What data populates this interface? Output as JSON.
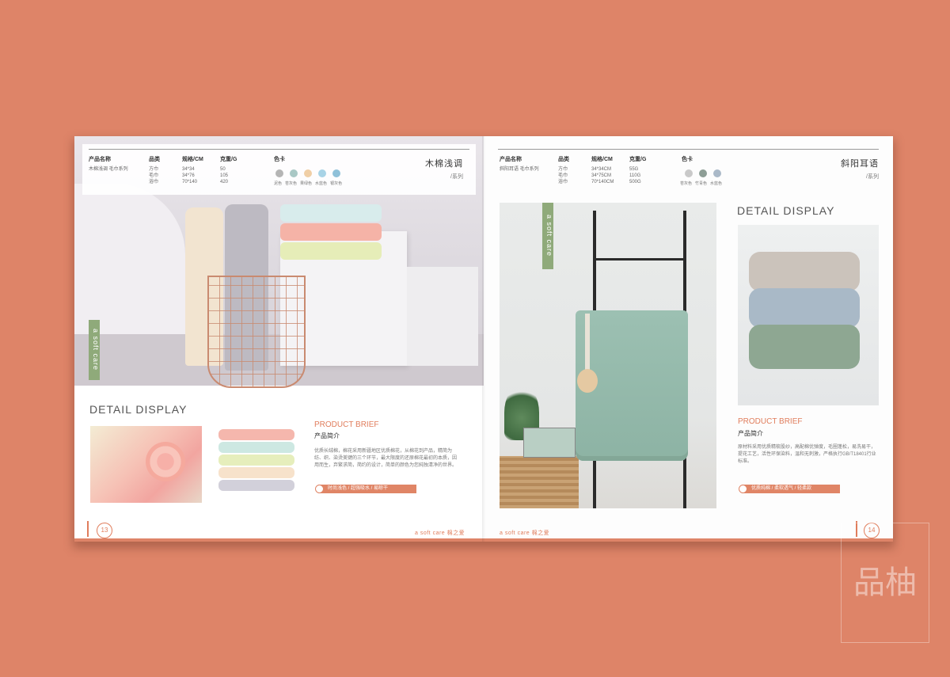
{
  "left_page": {
    "info": {
      "col1_head": "产品名称",
      "col1_rows": [
        "木棉浅调 毛巾系列"
      ],
      "col2_head": "品类",
      "col2_rows": [
        "方巾",
        "毛巾",
        "浴巾"
      ],
      "col3_head": "规格/CM",
      "col3_rows": [
        "34*34",
        "34*76",
        "70*140"
      ],
      "col4_head": "克重/G",
      "col4_rows": [
        "50",
        "105",
        "420"
      ],
      "color_head": "色卡",
      "swatch_colors": [
        "#b5b5b5",
        "#a9c8c5",
        "#f0cfa6",
        "#a8d3e6",
        "#8fc1d9"
      ],
      "swatch_labels": [
        "泥色",
        "苍灰色",
        "果绿色",
        "水蓝色",
        "银灰色"
      ]
    },
    "series_title": "木棉浅调",
    "series_sub": "/系列",
    "vertical_tag": "a soft care",
    "detail_title": "DETAIL DISPLAY",
    "brief_title": "PRODUCT BRIEF",
    "brief_sub": "产品简介",
    "brief_text": "优质长绒棉，棉花采用新疆地区优质棉花，从棉花到产品，精简为纺、织、染烫美键的三个环节，最大限度的还原棉花最初的本质，因用而生，弃繁求简，简约的设计，简单的颜色为您純独清净的世界。",
    "brief_bar": "时尚浅色 / 超强吸水 / 易晾干",
    "page_number": "13",
    "footer_brand": "a soft care 棉之爱"
  },
  "right_page": {
    "info": {
      "col1_head": "产品名称",
      "col1_rows": [
        "斜阳耳语 毛巾系列"
      ],
      "col2_head": "品类",
      "col2_rows": [
        "方巾",
        "毛巾",
        "浴巾"
      ],
      "col3_head": "规格/CM",
      "col3_rows": [
        "34*34CM",
        "34*75CM",
        "70*140CM"
      ],
      "col4_head": "克重/G",
      "col4_rows": [
        "55G",
        "110G",
        "500G"
      ],
      "color_head": "色卡",
      "swatch_colors": [
        "#c9c9c9",
        "#8e9e96",
        "#aab9c8"
      ],
      "swatch_labels": [
        "苍灰色",
        "竹青色",
        "水蓝色"
      ]
    },
    "series_title": "斜阳耳语",
    "series_sub": "/系列",
    "vertical_tag": "a soft care",
    "detail_title": "DETAIL DISPLAY",
    "brief_title": "PRODUCT BRIEF",
    "brief_sub": "产品简介",
    "brief_text": "原材料采用优质精梳股纱，高配棉优弹度，毛圈蓬松，易洗易干，提花工艺，活性环保染料，温和无刺激，严格执行GB/T18401行业标准。",
    "brief_bar": "优质纯棉 / 柔软透气 / 轻柔款",
    "page_number": "14",
    "footer_brand": "a soft care 棉之爱"
  },
  "watermark_text": "品柚"
}
